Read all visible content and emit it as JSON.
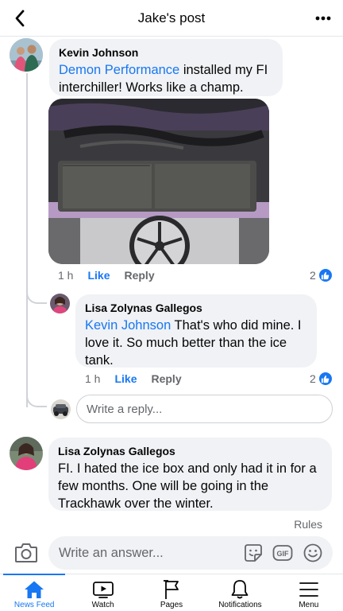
{
  "header": {
    "title": "Jake's post"
  },
  "comments": [
    {
      "author": "Kevin Johnson",
      "mention": "Demon Performance",
      "text": " installed my FI interchiller! Works like a champ.",
      "time": "1 h",
      "like_label": "Like",
      "reply_label": "Reply",
      "reaction_count": "2"
    },
    {
      "author": "Lisa Zolynas Gallegos",
      "mention": "Kevin Johnson",
      "text": " That's who did mine. I love it. So much better than the ice tank.",
      "time": "1 h",
      "like_label": "Like",
      "reply_label": "Reply",
      "reaction_count": "2"
    },
    {
      "author": "Lisa Zolynas Gallegos",
      "text": "FI. I hated the ice box and only had it in for a few months. One will be going in the Trackhawk over the winter."
    }
  ],
  "reply_box": {
    "placeholder": "Write a reply..."
  },
  "rules_label": "Rules",
  "composer": {
    "placeholder": "Write an answer..."
  },
  "tabs": [
    {
      "label": "News Feed",
      "icon": "home-icon",
      "active": true
    },
    {
      "label": "Watch",
      "icon": "watch-icon"
    },
    {
      "label": "Pages",
      "icon": "flag-icon"
    },
    {
      "label": "Notifications",
      "icon": "bell-icon"
    },
    {
      "label": "Menu",
      "icon": "menu-icon"
    }
  ],
  "colors": {
    "accent": "#1877f2",
    "bubble": "#f0f2f5",
    "muted": "#65676b"
  }
}
